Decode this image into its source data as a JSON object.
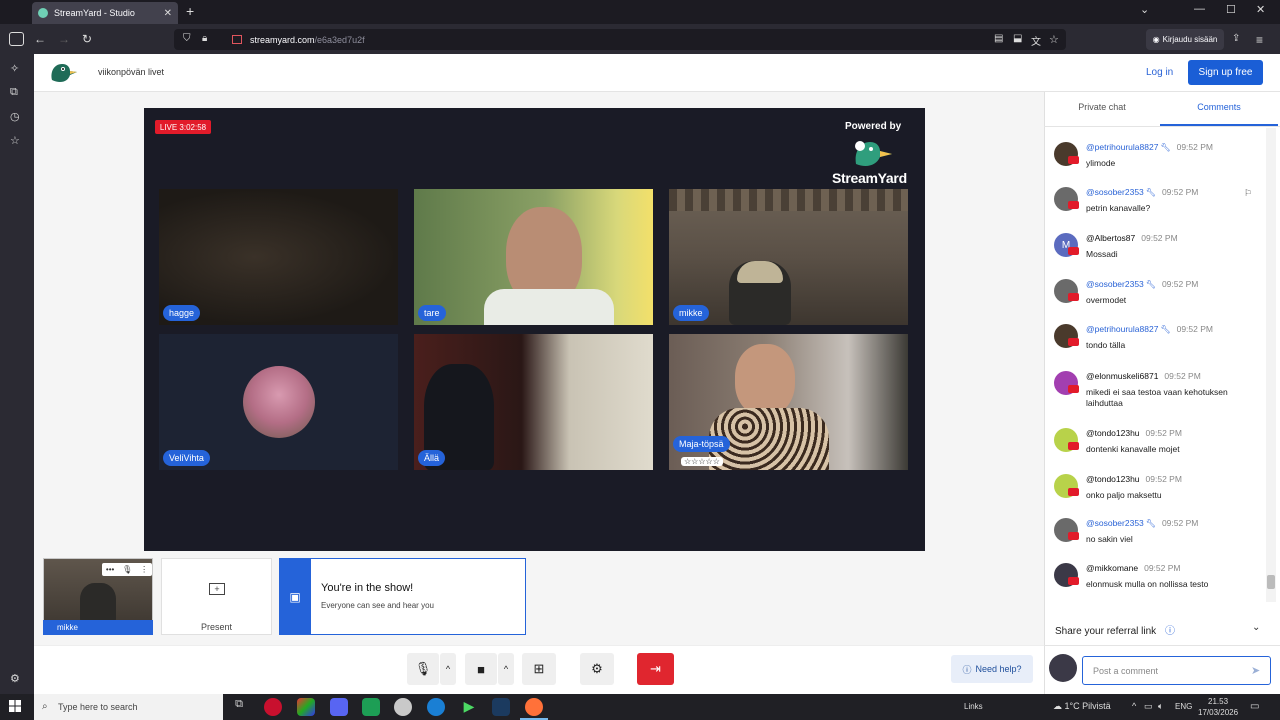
{
  "browser": {
    "tab_title": "StreamYard - Studio",
    "url_host": "streamyard.com",
    "url_path": "/e6a3ed7u2f",
    "signin_label": "Kirjaudu sisään"
  },
  "header": {
    "broadcast_title": "viikonpövän livet",
    "login_label": "Log in",
    "signup_label": "Sign up free"
  },
  "stage": {
    "live_badge": "LIVE 3:02:58",
    "powered_by": "Powered by",
    "brand": "StreamYard",
    "participants": [
      {
        "name": "hagge"
      },
      {
        "name": "tare"
      },
      {
        "name": "mikke"
      },
      {
        "name": "VeliVihta"
      },
      {
        "name": "Ällä"
      },
      {
        "name": "Maja-töpsä",
        "extra": "☆☆☆☆☆"
      }
    ]
  },
  "tray": {
    "self_name": "mikke",
    "present_label": "Present",
    "show_title": "You're in the show!",
    "show_subtitle": "Everyone can see and hear you"
  },
  "controls": {
    "help_label": "Need help?"
  },
  "panel": {
    "tab_private": "Private chat",
    "tab_comments": "Comments",
    "comments": [
      {
        "user": "@petrihourula8827",
        "time": "09:52 PM",
        "text": "ylimode",
        "mod": true,
        "color": "#4a3a2c"
      },
      {
        "user": "@sosober2353",
        "time": "09:52 PM",
        "text": "petrin kanavalle?",
        "mod": true,
        "color": "#6a6a6a"
      },
      {
        "user": "@Albertos87",
        "time": "09:52 PM",
        "text": "Mossadi",
        "mod": false,
        "color": "#5b6bbf",
        "initial": "M"
      },
      {
        "user": "@sosober2353",
        "time": "09:52 PM",
        "text": "overmodet",
        "mod": true,
        "color": "#6a6a6a"
      },
      {
        "user": "@petrihourula8827",
        "time": "09:52 PM",
        "text": "tondo tälla",
        "mod": true,
        "color": "#4a3a2c"
      },
      {
        "user": "@elonmuskeli6871",
        "time": "09:52 PM",
        "text": "mikedi ei saa testoa vaan kehotuksen laihduttaa",
        "mod": false,
        "color": "#a23fb0"
      },
      {
        "user": "@tondo123hu",
        "time": "09:52 PM",
        "text": "dontenki kanavalle mojet",
        "mod": false,
        "color": "#b8d24a"
      },
      {
        "user": "@tondo123hu",
        "time": "09:52 PM",
        "text": "onko paljo maksettu",
        "mod": false,
        "color": "#b8d24a"
      },
      {
        "user": "@sosober2353",
        "time": "09:52 PM",
        "text": "no sakin viel",
        "mod": true,
        "color": "#6a6a6a"
      },
      {
        "user": "@mikkomane",
        "time": "09:52 PM",
        "text": "elonmusk mulla on nollissa testo",
        "mod": false,
        "color": "#3b3947"
      }
    ],
    "referral_label": "Share your referral link",
    "comment_placeholder": "Post a comment"
  },
  "taskbar": {
    "search_placeholder": "Type here to search",
    "links_label": "Links",
    "weather": "1°C  Pilvistä",
    "lang": "ENG",
    "time": "21.53",
    "date": "17/03/2026"
  }
}
